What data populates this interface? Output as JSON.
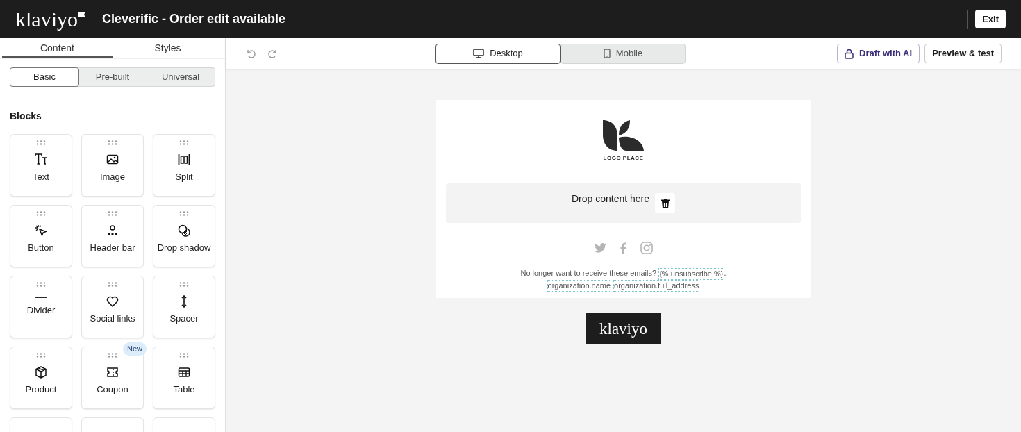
{
  "header": {
    "logo": "klaviyo",
    "title": "Cleverific - Order edit available",
    "exit": "Exit"
  },
  "sidebar": {
    "tabs": [
      {
        "label": "Content",
        "selected": true
      },
      {
        "label": "Styles",
        "selected": false
      }
    ],
    "segments": [
      {
        "label": "Basic",
        "selected": true
      },
      {
        "label": "Pre-built",
        "selected": false
      },
      {
        "label": "Universal",
        "selected": false
      }
    ],
    "heading": "Blocks",
    "blocks": [
      {
        "kind": "text",
        "label": "Text"
      },
      {
        "kind": "image",
        "label": "Image"
      },
      {
        "kind": "split",
        "label": "Split"
      },
      {
        "kind": "button",
        "label": "Button"
      },
      {
        "kind": "header",
        "label": "Header bar"
      },
      {
        "kind": "shadow",
        "label": "Drop shadow"
      },
      {
        "kind": "divider",
        "label": "Divider"
      },
      {
        "kind": "social",
        "label": "Social links"
      },
      {
        "kind": "spacer",
        "label": "Spacer"
      },
      {
        "kind": "product",
        "label": "Product"
      },
      {
        "kind": "coupon",
        "label": "Coupon",
        "badge": "New"
      },
      {
        "kind": "table",
        "label": "Table"
      }
    ]
  },
  "toolbar": {
    "views": [
      {
        "label": "Desktop",
        "kind": "desktop",
        "selected": true
      },
      {
        "label": "Mobile",
        "kind": "mobile",
        "selected": false
      }
    ],
    "draft": "Draft with AI",
    "preview": "Preview & test"
  },
  "email": {
    "logo_caption": "LOGO PLACE",
    "drop_text": "Drop content here",
    "footer_lines": [
      [
        {
          "kind": "plain",
          "text": "No longer want to receive these emails? "
        },
        {
          "kind": "token",
          "text": "{% unsubscribe %}"
        },
        {
          "kind": "plain",
          "text": "."
        }
      ],
      [
        {
          "kind": "token",
          "text": "organization.name"
        },
        {
          "kind": "token",
          "text": "organization.full_address"
        }
      ]
    ],
    "badge": "klaviyo"
  }
}
